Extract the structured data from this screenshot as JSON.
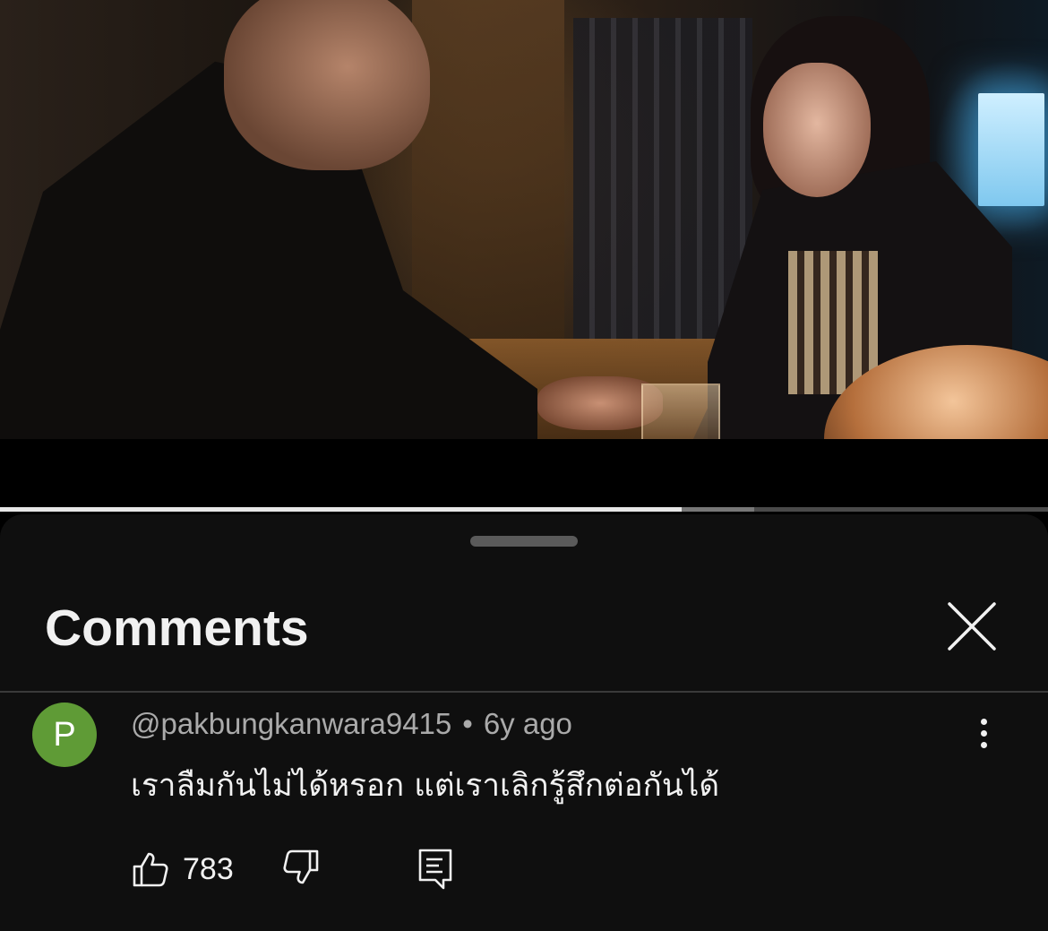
{
  "video": {
    "progress_played": 0.65,
    "progress_buffered": 0.72
  },
  "comments_panel": {
    "title": "Comments",
    "close_icon": "close-icon"
  },
  "comment": {
    "avatar_letter": "P",
    "avatar_color": "#5f9b36",
    "author": "@pakbungkanwara9415",
    "separator": "•",
    "time": "6y ago",
    "text": "เราลืมกันไม่ได้หรอก แต่เราเลิกรู้สึกต่อกันได้",
    "likes": "783",
    "like_icon": "thumb-up-icon",
    "dislike_icon": "thumb-down-icon",
    "reply_icon": "reply-icon",
    "more_icon": "more-vertical-icon"
  }
}
